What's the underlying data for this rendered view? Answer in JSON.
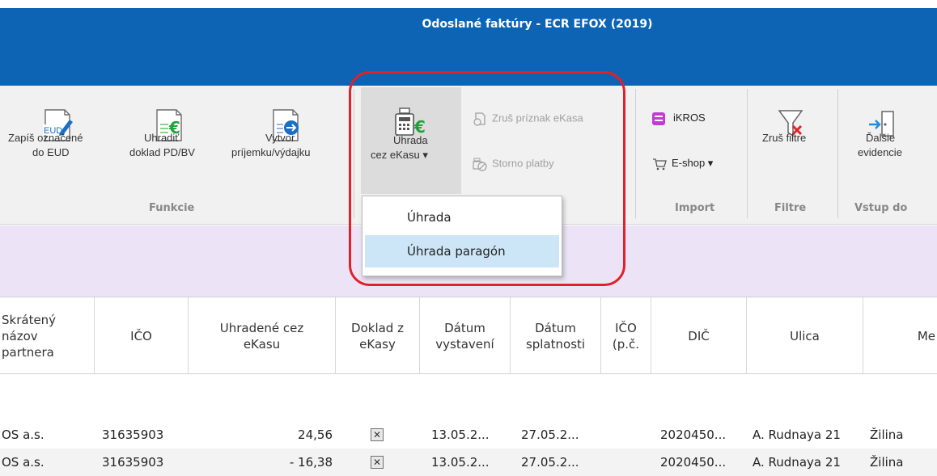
{
  "window": {
    "title": "Odoslané faktúry - ECR EFOX (2019)"
  },
  "ribbon": {
    "funkcie": {
      "label": "Funkcie",
      "zapis": {
        "line1": "Zapíš označené",
        "line2": "do EUD",
        "icon": "eud-document-icon"
      },
      "uhradit": {
        "line1": "Uhradiť",
        "line2": "doklad PD/BV",
        "icon": "euro-document-icon"
      },
      "vytvor": {
        "line1": "Vytvor",
        "line2": "príjemku/výdajku",
        "icon": "arrow-document-icon"
      }
    },
    "ekasa": {
      "uhrada": {
        "line1": "Úhrada",
        "line2": "cez eKasu ▾",
        "icon": "cash-register-euro-icon"
      },
      "zrus_priznak": "Zruš príznak eKasa",
      "storno": "Storno platby"
    },
    "import": {
      "label": "Import",
      "ikros": "iKROS",
      "eshop": "E-shop ▾"
    },
    "filtre": {
      "label": "Filtre",
      "zrus_filtre": "Zruš filtre"
    },
    "vstup": {
      "label": "Vstup do",
      "dalsie": {
        "line1": "Ďalšie",
        "line2": "evidencie"
      }
    }
  },
  "dropdown": {
    "items": [
      "Úhrada",
      "Úhrada paragón"
    ]
  },
  "table": {
    "headers": {
      "skrateny": "Skrátený\nnázov\npartnera",
      "ico": "IČO",
      "uhradene": "Uhradené cez\neKasu",
      "doklad": "Doklad z\neKasy",
      "vystaveni": "Dátum\nvystavení",
      "splatnosti": "Dátum\nsplatnosti",
      "icopc": "IČO\n(p.č.",
      "dic": "DIČ",
      "ulica": "Ulica",
      "mesto": "Me"
    },
    "rows": [
      {
        "partner": "OS a.s.",
        "ico": "31635903",
        "amount": "24,56",
        "doklad": "✕",
        "vystaveni": "13.05.2...",
        "splatnosti": "27.05.2...",
        "dic": "2020450...",
        "ulica": "A. Rudnaya 21",
        "mesto": "Žilina"
      },
      {
        "partner": "OS a.s.",
        "ico": "31635903",
        "amount": "- 16,38",
        "doklad": "✕",
        "vystaveni": "13.05.2...",
        "splatnosti": "27.05.2...",
        "dic": "2020450...",
        "ulica": "A. Rudnaya 21",
        "mesto": "Žilina"
      }
    ]
  },
  "colors": {
    "titlebar": "#0d64b4",
    "band": "#ece4f6",
    "highlight": "#cde6f7",
    "redbox": "#e0202a"
  }
}
